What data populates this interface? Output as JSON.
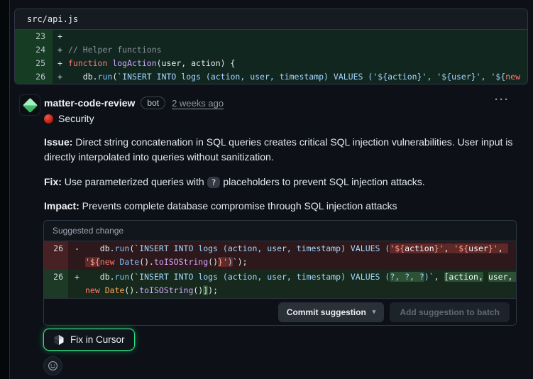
{
  "colors": {
    "accent_ring_green": "#2ee37f",
    "avatar_diamond_light": "#a4f0bf",
    "avatar_diamond_dark": "#3aa862",
    "security_dot_red": "#bc2015",
    "addition_green": "#2ea043",
    "deletion_red": "#f85149"
  },
  "file_header": {
    "path": "src/api.js"
  },
  "top_diff": {
    "rows": [
      {
        "num": "23",
        "sign": "+",
        "tokens": []
      },
      {
        "num": "24",
        "sign": "+",
        "tokens": [
          {
            "c": "cm",
            "t": "// Helper functions"
          }
        ]
      },
      {
        "num": "25",
        "sign": "+",
        "tokens": [
          {
            "c": "kw",
            "t": "function"
          },
          {
            "c": "fg",
            "t": " "
          },
          {
            "c": "fn",
            "t": "logAction"
          },
          {
            "c": "fg",
            "t": "(user, action) {"
          }
        ]
      },
      {
        "num": "26",
        "sign": "+",
        "tokens": [
          {
            "c": "fg",
            "t": "   db."
          },
          {
            "c": "cb",
            "t": "run"
          },
          {
            "c": "fg",
            "t": "("
          },
          {
            "c": "str",
            "t": "`INSERT INTO logs (action, user, timestamp) VALUES ('${action}', '${user}', '${"
          },
          {
            "c": "kw",
            "t": "new"
          }
        ]
      }
    ]
  },
  "comment": {
    "author": "matter-code-review",
    "badge": "bot",
    "timestamp": "2 weeks ago",
    "kebab": "···",
    "category": "Security",
    "issue": {
      "label": "Issue:",
      "text": " Direct string concatenation in SQL queries creates critical SQL injection vulnerabilities. User input is directly interpolated into queries without sanitization."
    },
    "fix": {
      "label": "Fix:",
      "pre": " Use parameterized queries with ",
      "code": "?",
      "post": " placeholders to prevent SQL injection attacks."
    },
    "impact": {
      "label": "Impact:",
      "text": " Prevents complete database compromise through SQL injection attacks"
    },
    "suggestion": {
      "title": "Suggested change",
      "del_row": {
        "num": "26",
        "sign": "-",
        "tokens": [
          {
            "c": "fg",
            "t": "   db."
          },
          {
            "c": "cb",
            "t": "run"
          },
          {
            "c": "fg",
            "t": "("
          },
          {
            "c": "str",
            "t": "`INSERT INTO logs (action, user, timestamp) VALUES ("
          },
          {
            "c": "sal",
            "h": "d",
            "t": "'${"
          },
          {
            "c": "fgl",
            "h": "d",
            "t": "action"
          },
          {
            "c": "sal",
            "h": "d",
            "t": "}'"
          },
          {
            "c": "fgl",
            "h": "d",
            "t": ", "
          },
          {
            "c": "sal",
            "h": "d",
            "t": "'${"
          },
          {
            "c": "fgl",
            "h": "d",
            "t": "user"
          },
          {
            "c": "sal",
            "h": "d",
            "t": "}'"
          },
          {
            "c": "fgl",
            "h": "d",
            "t": ", "
          },
          {
            "br": true
          },
          {
            "c": "sal",
            "h": "d",
            "t": "'${"
          },
          {
            "c": "kw",
            "t": "new"
          },
          {
            "c": "fg",
            "t": " "
          },
          {
            "c": "cb",
            "t": "Date"
          },
          {
            "c": "fg",
            "t": "()."
          },
          {
            "c": "pu",
            "t": "toISOString"
          },
          {
            "c": "fg",
            "t": "()"
          },
          {
            "c": "sal",
            "h": "d",
            "t": "}'"
          },
          {
            "c": "str",
            "h": "d",
            "t": ")"
          },
          {
            "c": "str",
            "t": "`"
          },
          {
            "c": "fg",
            "t": ");"
          }
        ]
      },
      "add_row": {
        "num": "26",
        "sign": "+",
        "tokens": [
          {
            "c": "fg",
            "t": "   db."
          },
          {
            "c": "cb",
            "t": "run"
          },
          {
            "c": "fg",
            "t": "("
          },
          {
            "c": "str",
            "t": "`INSERT INTO logs (action, user, timestamp) VALUES ("
          },
          {
            "c": "str",
            "h": "a",
            "t": "?, ?, ?"
          },
          {
            "c": "str",
            "t": ")`"
          },
          {
            "c": "fg",
            "t": ", "
          },
          {
            "c": "fgl",
            "h": "a",
            "t": "[action,"
          },
          {
            "c": "fg",
            "t": " "
          },
          {
            "c": "fgl",
            "h": "a",
            "t": "user, "
          },
          {
            "br": true
          },
          {
            "c": "kw",
            "t": "new"
          },
          {
            "c": "fg",
            "t": " "
          },
          {
            "c": "or",
            "t": "Date"
          },
          {
            "c": "fg",
            "t": "()."
          },
          {
            "c": "pu",
            "t": "toISOString"
          },
          {
            "c": "fg",
            "t": "()"
          },
          {
            "c": "fgl",
            "h": "a",
            "t": "]"
          },
          {
            "c": "fg",
            "t": ");"
          }
        ]
      },
      "commit_label": "Commit suggestion",
      "commit_caret": "▾",
      "batch_label": "Add suggestion to batch"
    },
    "fix_button_label": "Fix in Cursor"
  }
}
